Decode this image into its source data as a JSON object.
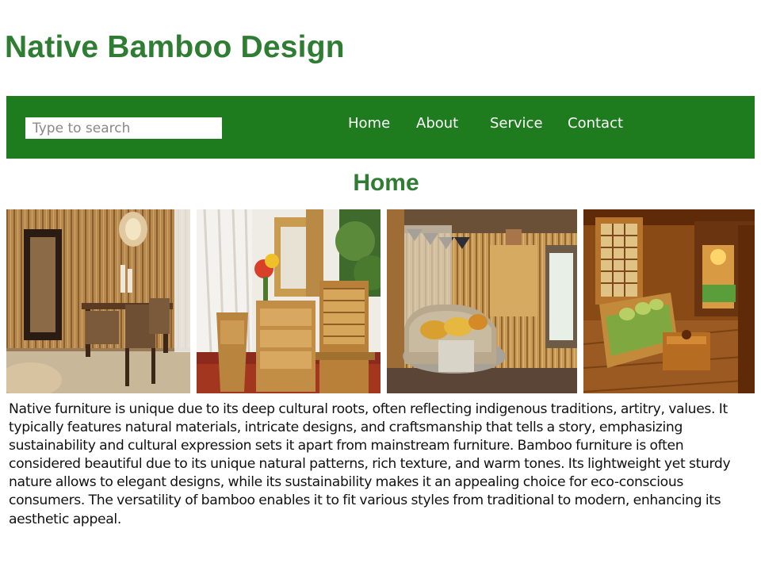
{
  "site": {
    "title": "Native Bamboo Design"
  },
  "nav": {
    "search_placeholder": "Type to search",
    "links": [
      "Home",
      "About",
      "Service",
      "Contact"
    ]
  },
  "main": {
    "heading": "Home",
    "gallery": [
      {
        "name": "bamboo-dining-room"
      },
      {
        "name": "bamboo-furniture-set"
      },
      {
        "name": "bamboo-wall-lounge"
      },
      {
        "name": "bamboo-bedroom"
      }
    ],
    "description": "Native furniture is unique due to its deep cultural roots, often reflecting indigenous traditions, artitry, values. It typically features natural materials, intricate designs, and craftsmanship that tells a story, emphasizing sustainability and cultural expression sets it apart from mainstream furniture. Bamboo furniture is often considered beautiful due to its unique natural patterns, rich texture, and warm tones. Its lightweight yet sturdy nature allows to elegant designs, while its sustainability makes it an appealing choice for eco-conscious consumers. The versatility of bamboo enables it to fit various styles from traditional to modern, enhancing its aesthetic appeal."
  },
  "colors": {
    "brand_green": "#2e7d32",
    "nav_green": "#1e7b1e"
  }
}
